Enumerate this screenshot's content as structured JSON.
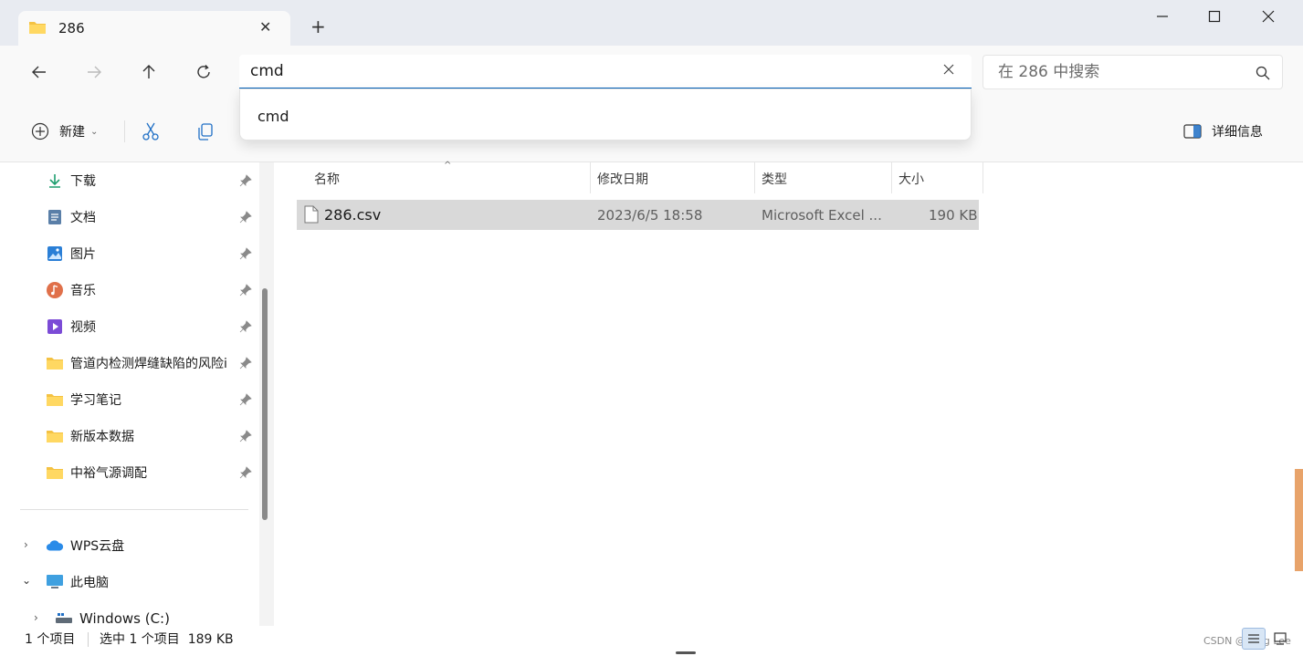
{
  "window": {
    "tab_title": "286",
    "new_tab_label": "+",
    "minimize": "—",
    "maximize": "☐",
    "close": "✕"
  },
  "nav": {
    "address_value": "cmd",
    "search_placeholder": "在 286 中搜索"
  },
  "dropdown": {
    "items": [
      "cmd"
    ]
  },
  "command_bar": {
    "new_label": "新建",
    "details_label": "详细信息"
  },
  "sidebar": {
    "quick_access": [
      {
        "label": "下载",
        "icon": "download-icon"
      },
      {
        "label": "文档",
        "icon": "document-icon"
      },
      {
        "label": "图片",
        "icon": "pictures-icon"
      },
      {
        "label": "音乐",
        "icon": "music-icon"
      },
      {
        "label": "视频",
        "icon": "video-icon"
      },
      {
        "label": "管道内检测焊缝缺陷的风险i",
        "icon": "folder-icon"
      },
      {
        "label": "学习笔记",
        "icon": "folder-icon"
      },
      {
        "label": "新版本数据",
        "icon": "folder-icon"
      },
      {
        "label": "中裕气源调配",
        "icon": "folder-icon"
      }
    ],
    "tree": [
      {
        "label": "WPS云盘",
        "icon": "cloud-icon"
      },
      {
        "label": "此电脑",
        "icon": "computer-icon"
      },
      {
        "label": "Windows (C:)",
        "icon": "drive-icon"
      }
    ]
  },
  "files": {
    "columns": [
      "名称",
      "修改日期",
      "类型",
      "大小"
    ],
    "rows": [
      {
        "name": "286.csv",
        "modified": "2023/6/5 18:58",
        "type": "Microsoft Excel ...",
        "size": "190 KB"
      }
    ]
  },
  "status": {
    "count": "1 个项目",
    "selected": "选中 1 个项目  189 KB",
    "watermark": "CSDN @Eling Lee"
  },
  "colors": {
    "accent": "#005fb8",
    "selection": "#d9d9d9",
    "titlebar": "#e8ebf1"
  }
}
